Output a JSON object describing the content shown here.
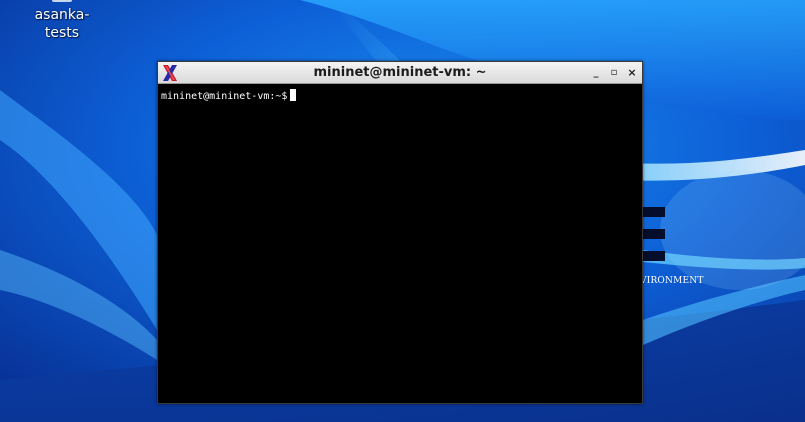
{
  "desktop": {
    "icon_label_line1": "asanka-",
    "icon_label_line2": "tests",
    "brand_text_fragment": "VIRONMENT"
  },
  "window": {
    "title": "mininet@mininet-vm: ~",
    "minimize_glyph": "_",
    "maximize_glyph": "▫",
    "close_glyph": "×",
    "app_icon": "xterm-x-icon"
  },
  "terminal": {
    "prompt": "mininet@mininet-vm:~$"
  },
  "colors": {
    "wallpaper_base": "#0a3fb0",
    "terminal_bg": "#000000",
    "terminal_fg": "#ffffff",
    "titlebar": "#e8e8e8"
  }
}
